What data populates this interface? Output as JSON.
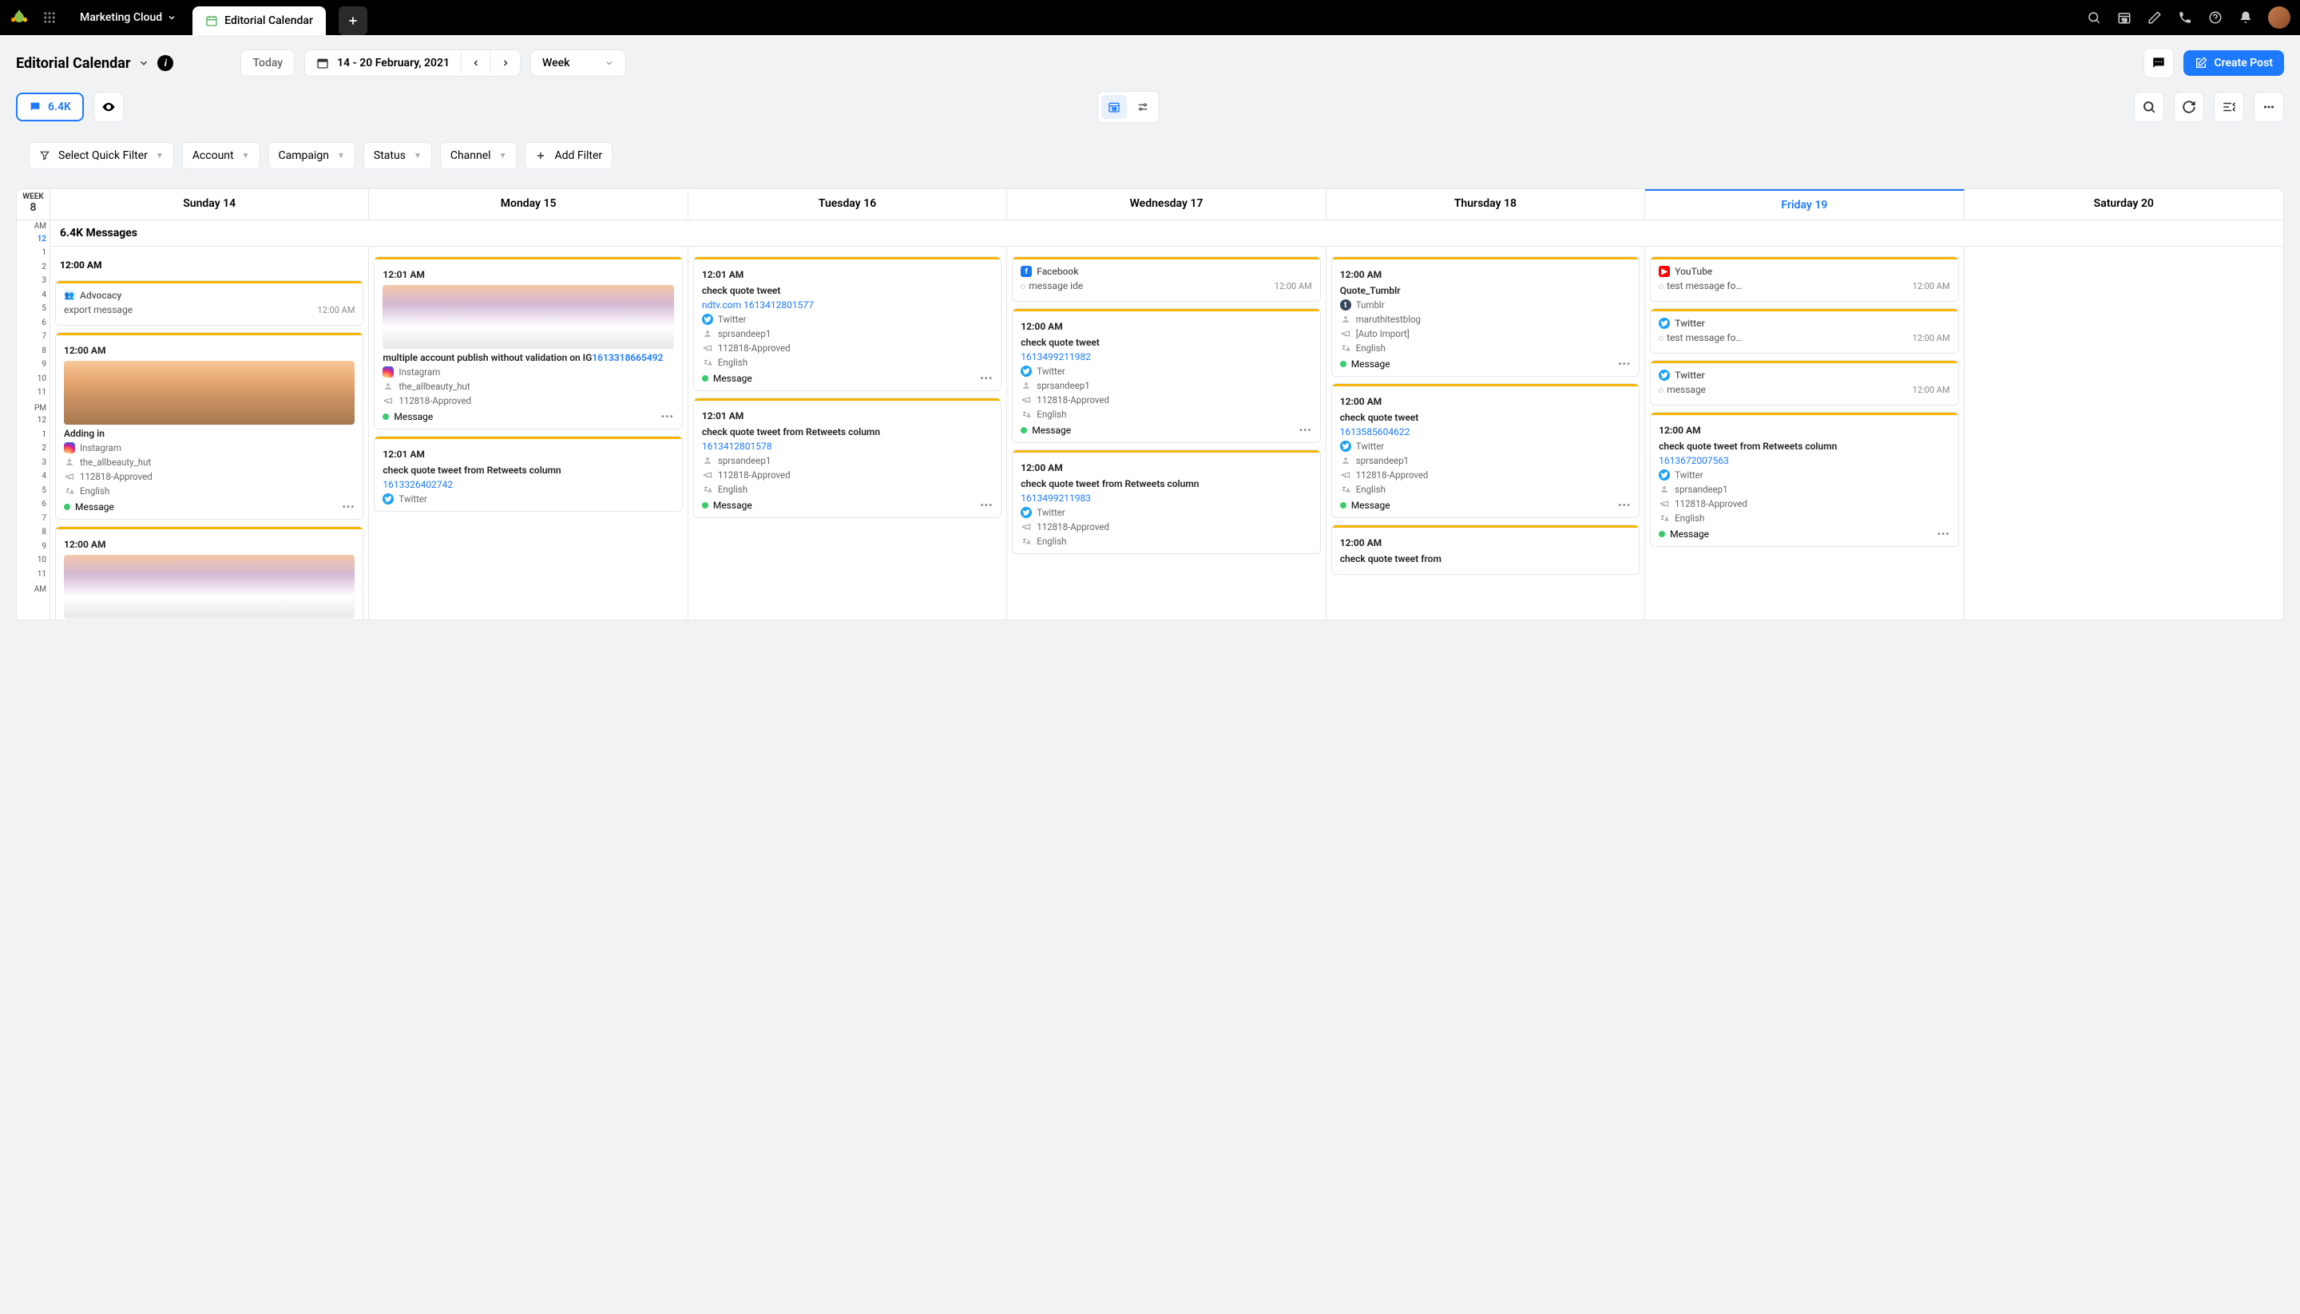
{
  "topbar": {
    "cloud_label": "Marketing Cloud",
    "tab_label": "Editorial Calendar"
  },
  "header": {
    "page_title": "Editorial Calendar",
    "today_label": "Today",
    "date_range": "14 - 20 February, 2021",
    "view_select": "Week",
    "create_label": "Create Post"
  },
  "toolbar": {
    "message_count": "6.4K"
  },
  "filters": {
    "quick": "Select Quick Filter",
    "account": "Account",
    "campaign": "Campaign",
    "status": "Status",
    "channel": "Channel",
    "add": "Add Filter"
  },
  "calendar": {
    "week_label": "WEEK",
    "week_num": "8",
    "days": [
      {
        "label": "Sunday 14"
      },
      {
        "label": "Monday 15"
      },
      {
        "label": "Tuesday 16"
      },
      {
        "label": "Wednesday 17"
      },
      {
        "label": "Thursday 18"
      },
      {
        "label": "Friday 19",
        "today": true
      },
      {
        "label": "Saturday 20"
      }
    ],
    "messages_header": "6.4K Messages",
    "time_labels": {
      "am": "AM",
      "pm": "PM",
      "hours": [
        "12",
        "1",
        "2",
        "3",
        "4",
        "5",
        "6",
        "7",
        "8",
        "9",
        "10",
        "11"
      ]
    },
    "slot_label": "12:00 AM"
  },
  "cards": {
    "sun": [
      {
        "channel": "Advocacy",
        "ch_icon": "advocacy",
        "title_inline": "export message",
        "time": "12:00 AM"
      },
      {
        "time_header": "12:00 AM",
        "thumb": "sunset",
        "title": "Adding in",
        "metas": [
          {
            "icon": "instagram",
            "text": "Instagram"
          },
          {
            "icon": "user",
            "text": "the_allbeauty_hut"
          },
          {
            "icon": "campaign",
            "text": "112818-Approved"
          },
          {
            "icon": "lang",
            "text": "English"
          }
        ],
        "status": "Message",
        "has_thumb": true
      },
      {
        "time_header": "12:00 AM",
        "thumb": "mountain",
        "has_thumb": true,
        "truncated": true
      }
    ],
    "mon": [
      {
        "time_header": "12:01 AM",
        "thumb": "mountain",
        "has_thumb": true,
        "title": "multiple account publish without validation on IG",
        "link_inline": "1613318665492",
        "metas": [
          {
            "icon": "instagram",
            "text": "Instagram"
          },
          {
            "icon": "user",
            "text": "the_allbeauty_hut"
          },
          {
            "icon": "campaign",
            "text": "112818-Approved"
          }
        ],
        "status": "Message"
      },
      {
        "time_header": "12:01 AM",
        "title": "check quote tweet from Retweets column",
        "link": "1613326402742",
        "metas": [
          {
            "icon": "twitter",
            "text": "Twitter"
          }
        ],
        "truncated": true
      }
    ],
    "tue": [
      {
        "time_header": "12:01 AM",
        "title": "check quote tweet",
        "link": "ndtv.com 1613412801577",
        "metas": [
          {
            "icon": "twitter",
            "text": "Twitter"
          },
          {
            "icon": "user",
            "text": "sprsandeep1"
          },
          {
            "icon": "campaign",
            "text": "112818-Approved"
          },
          {
            "icon": "lang",
            "text": "English"
          }
        ],
        "status": "Message"
      },
      {
        "time_header": "12:01 AM",
        "title": "check quote tweet from Retweets column",
        "link": "1613412801578",
        "metas": [
          {
            "icon": "user",
            "text": "sprsandeep1"
          },
          {
            "icon": "campaign",
            "text": "112818-Approved"
          },
          {
            "icon": "lang",
            "text": "English"
          }
        ],
        "status": "Message"
      }
    ],
    "wed": [
      {
        "channel": "Facebook",
        "ch_icon": "facebook",
        "title_inline": "message ide",
        "time": "12:00 AM",
        "dot": true
      },
      {
        "time_header": "12:00 AM",
        "title": "check quote tweet",
        "link": "1613499211982",
        "metas": [
          {
            "icon": "twitter",
            "text": "Twitter"
          },
          {
            "icon": "user",
            "text": "sprsandeep1"
          },
          {
            "icon": "campaign",
            "text": "112818-Approved"
          },
          {
            "icon": "lang",
            "text": "English"
          }
        ],
        "status": "Message"
      },
      {
        "time_header": "12:00 AM",
        "title": "check quote tweet from Retweets column",
        "link": "1613499211983",
        "metas": [
          {
            "icon": "twitter",
            "text": "Twitter"
          },
          {
            "icon": "campaign",
            "text": "112818-Approved"
          },
          {
            "icon": "lang",
            "text": "English"
          }
        ],
        "truncated": true
      }
    ],
    "thu": [
      {
        "time_header": "12:00 AM",
        "title": "Quote_Tumblr",
        "metas": [
          {
            "icon": "tumblr",
            "text": "Tumblr"
          },
          {
            "icon": "user",
            "text": "maruthitestblog"
          },
          {
            "icon": "campaign",
            "text": "[Auto Import]"
          },
          {
            "icon": "lang",
            "text": "English"
          }
        ],
        "status": "Message"
      },
      {
        "time_header": "12:00 AM",
        "title": "check quote tweet",
        "link": "1613585604622",
        "metas": [
          {
            "icon": "twitter",
            "text": "Twitter"
          },
          {
            "icon": "user",
            "text": "sprsandeep1"
          },
          {
            "icon": "campaign",
            "text": "112818-Approved"
          },
          {
            "icon": "lang",
            "text": "English"
          }
        ],
        "status": "Message"
      },
      {
        "time_header": "12:00 AM",
        "title": "check quote tweet from",
        "truncated": true
      }
    ],
    "fri": [
      {
        "channel": "YouTube",
        "ch_icon": "youtube",
        "title_inline": "test message fo…",
        "time": "12:00 AM",
        "dot": true
      },
      {
        "channel": "Twitter",
        "ch_icon": "twitter",
        "title_inline": "test message fo…",
        "time": "12:00 AM",
        "dot": true
      },
      {
        "channel": "Twitter",
        "ch_icon": "twitter",
        "title_inline": "message",
        "time": "12:00 AM",
        "dot": true
      },
      {
        "time_header": "12:00 AM",
        "title": "check quote tweet from Retweets column",
        "link": "1613672007563",
        "metas": [
          {
            "icon": "twitter",
            "text": "Twitter"
          },
          {
            "icon": "user",
            "text": "sprsandeep1"
          },
          {
            "icon": "campaign",
            "text": "112818-Approved"
          },
          {
            "icon": "lang",
            "text": "English"
          }
        ],
        "status": "Message"
      }
    ],
    "sat": []
  }
}
